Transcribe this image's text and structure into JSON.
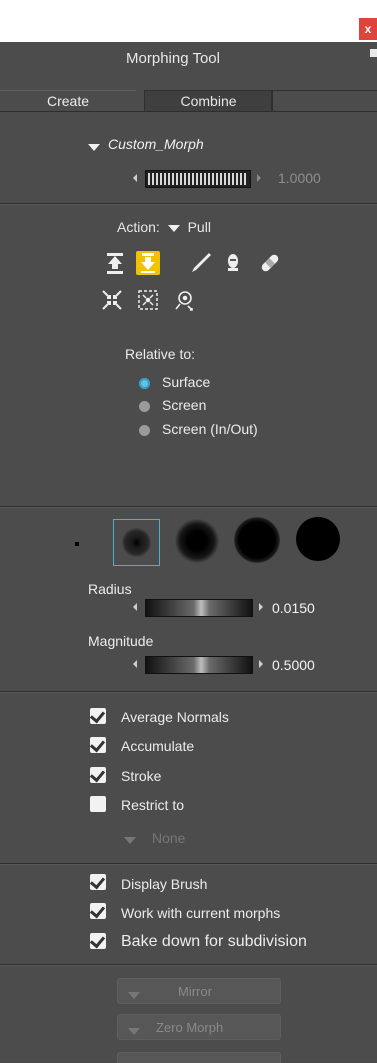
{
  "window": {
    "close_label": "x",
    "title": "Morphing Tool"
  },
  "tabs": [
    {
      "label": "Create",
      "active": true
    },
    {
      "label": "Combine",
      "active": false
    }
  ],
  "morph": {
    "name": "Custom_Morph",
    "value": "1.0000"
  },
  "action": {
    "label": "Action:",
    "value": "Pull",
    "tools_row1": [
      "pull-up-icon",
      "pull-down-icon",
      "brush-pen-icon",
      "smooth-bulb-icon",
      "bandage-icon"
    ],
    "tools_row2": [
      "pinch-icon",
      "inflate-box-icon",
      "restore-magnifier-icon"
    ]
  },
  "relative": {
    "label": "Relative to:",
    "options": [
      {
        "label": "Surface",
        "selected": true
      },
      {
        "label": "Screen",
        "selected": false
      },
      {
        "label": "Screen (In/Out)",
        "selected": false
      }
    ]
  },
  "brush": {
    "radius_label": "Radius",
    "radius_value": "0.0150",
    "magnitude_label": "Magnitude",
    "magnitude_value": "0.5000"
  },
  "options": [
    {
      "label": "Average Normals",
      "checked": true
    },
    {
      "label": "Accumulate",
      "checked": true
    },
    {
      "label": "Stroke",
      "checked": true
    },
    {
      "label": "Restrict to",
      "checked": false
    }
  ],
  "restrict_value": "None",
  "display_options": [
    {
      "label": "Display Brush",
      "checked": true
    },
    {
      "label": "Work with current morphs",
      "checked": true
    },
    {
      "label": "Bake down for subdivision",
      "checked": true
    }
  ],
  "buttons": {
    "mirror": "Mirror",
    "zero_morph": "Zero Morph"
  },
  "colors": {
    "panel_bg": "#4c4c4c",
    "accent": "#f2c200",
    "radio_selected": "#5dc3e3",
    "close_bg": "#e0433a"
  }
}
